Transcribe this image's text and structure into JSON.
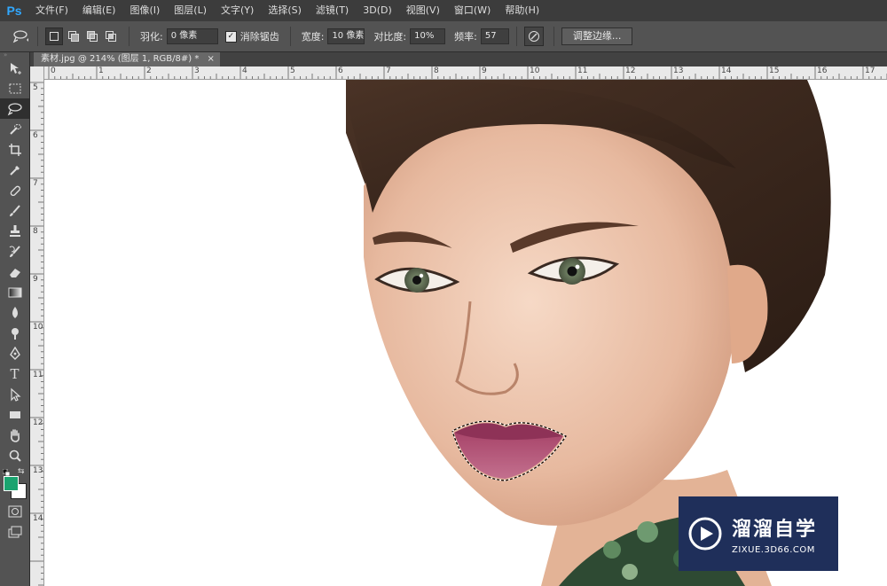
{
  "app": {
    "logo": "Ps"
  },
  "menu": [
    "文件(F)",
    "编辑(E)",
    "图像(I)",
    "图层(L)",
    "文字(Y)",
    "选择(S)",
    "滤镜(T)",
    "3D(D)",
    "视图(V)",
    "窗口(W)",
    "帮助(H)"
  ],
  "options": {
    "tool_icon": "magnetic-lasso-icon",
    "feather_label": "羽化:",
    "feather_value": "0 像素",
    "antialias_label": "消除锯齿",
    "antialias_checked": true,
    "width_label": "宽度:",
    "width_value": "10 像素",
    "contrast_label": "对比度:",
    "contrast_value": "10%",
    "frequency_label": "频率:",
    "frequency_value": "57",
    "refine_edge": "调整边缘..."
  },
  "document": {
    "tab_title": "素材.jpg @ 214% (图层 1, RGB/8#) *",
    "close": "×"
  },
  "rulers": {
    "top": [
      "0",
      "1",
      "2",
      "3",
      "4",
      "5",
      "6",
      "7",
      "8",
      "9",
      "10",
      "11",
      "12",
      "13",
      "14",
      "15",
      "16",
      "17"
    ],
    "left": [
      "5",
      "6",
      "7",
      "8",
      "9",
      "10",
      "11",
      "12",
      "13",
      "14"
    ]
  },
  "colors": {
    "foreground": "#1aa36f",
    "background": "#ffffff",
    "ps_blue": "#31a8ff",
    "watermark_bg": "#1f2f5a"
  },
  "watermark": {
    "title": "溜溜自学",
    "subtitle": "ZIXUE.3D66.COM"
  }
}
